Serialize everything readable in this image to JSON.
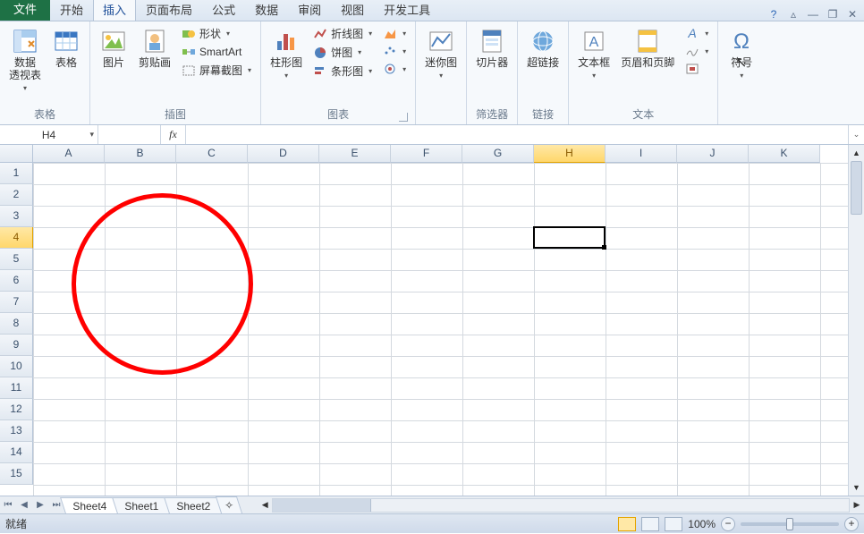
{
  "tabs": {
    "file": "文件",
    "items": [
      "开始",
      "插入",
      "页面布局",
      "公式",
      "数据",
      "审阅",
      "视图",
      "开发工具"
    ],
    "active_index": 1
  },
  "ribbon": {
    "tables": {
      "pivot": "数据\n透视表",
      "table": "表格",
      "label": "表格"
    },
    "illust": {
      "picture": "图片",
      "clipart": "剪贴画",
      "shapes": "形状",
      "smartart": "SmartArt",
      "screenshot": "屏幕截图",
      "label": "插图"
    },
    "charts": {
      "column": "柱形图",
      "line": "折线图",
      "pie": "饼图",
      "bar": "条形图",
      "label": "图表"
    },
    "spark": {
      "sparkline": "迷你图",
      "slicer": "切片器",
      "filter_label": "筛选器"
    },
    "link": {
      "hyperlink": "超链接",
      "label": "链接"
    },
    "text": {
      "textbox": "文本框",
      "headerfooter": "页眉和页脚",
      "label": "文本"
    },
    "symbol": {
      "symbol": "符号"
    }
  },
  "namebox": "H4",
  "fx": "fx",
  "columns": [
    "A",
    "B",
    "C",
    "D",
    "E",
    "F",
    "G",
    "H",
    "I",
    "J",
    "K"
  ],
  "rows": [
    "1",
    "2",
    "3",
    "4",
    "5",
    "6",
    "7",
    "8",
    "9",
    "10",
    "11",
    "12",
    "13",
    "14",
    "15"
  ],
  "selected_col_index": 7,
  "selected_row_index": 3,
  "sheets": {
    "items": [
      "Sheet4",
      "Sheet1",
      "Sheet2"
    ],
    "active_index": 0
  },
  "status": {
    "ready": "就绪",
    "zoom": "100%"
  }
}
